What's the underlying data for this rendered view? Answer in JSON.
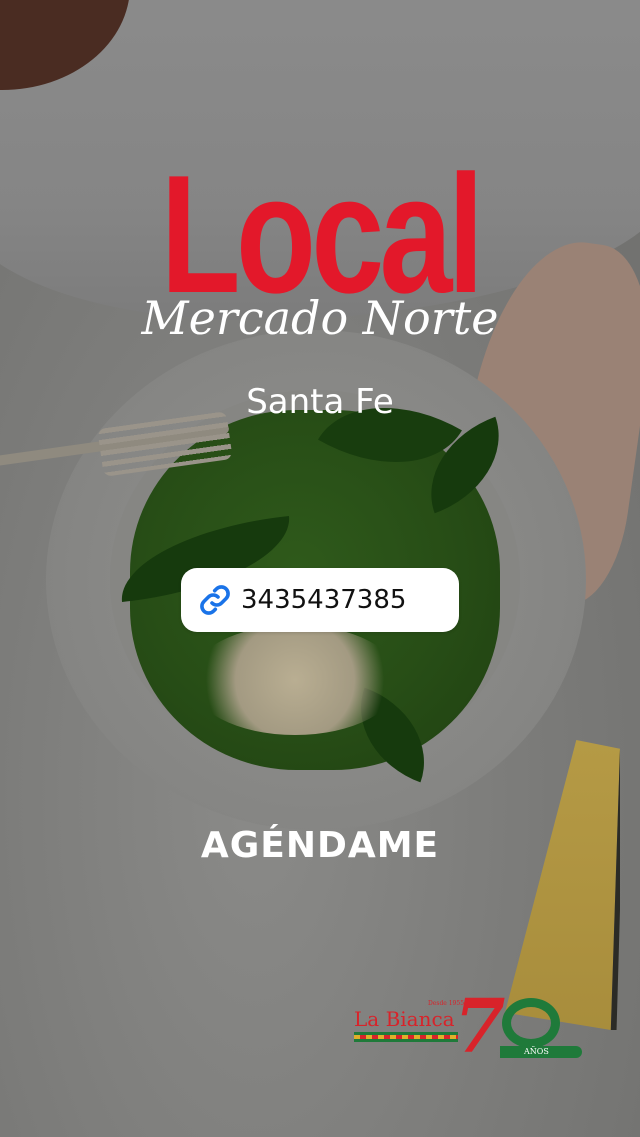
{
  "story": {
    "title": "Local",
    "subtitle": "Mercado Norte",
    "city": "Santa Fe",
    "link_sticker": {
      "icon": "link-icon",
      "text": "3435437385"
    },
    "cta": "AGÉNDAME"
  },
  "logo": {
    "brand": "La Bianca",
    "since": "Desde 1955",
    "anniversary_number": "70",
    "anniversary_word": "AÑOS"
  },
  "colors": {
    "title_red": "#e3182a",
    "text_white": "#ffffff",
    "link_blue": "#1a73e8",
    "logo_green": "#1f7a3a",
    "logo_red": "#d8232a"
  }
}
